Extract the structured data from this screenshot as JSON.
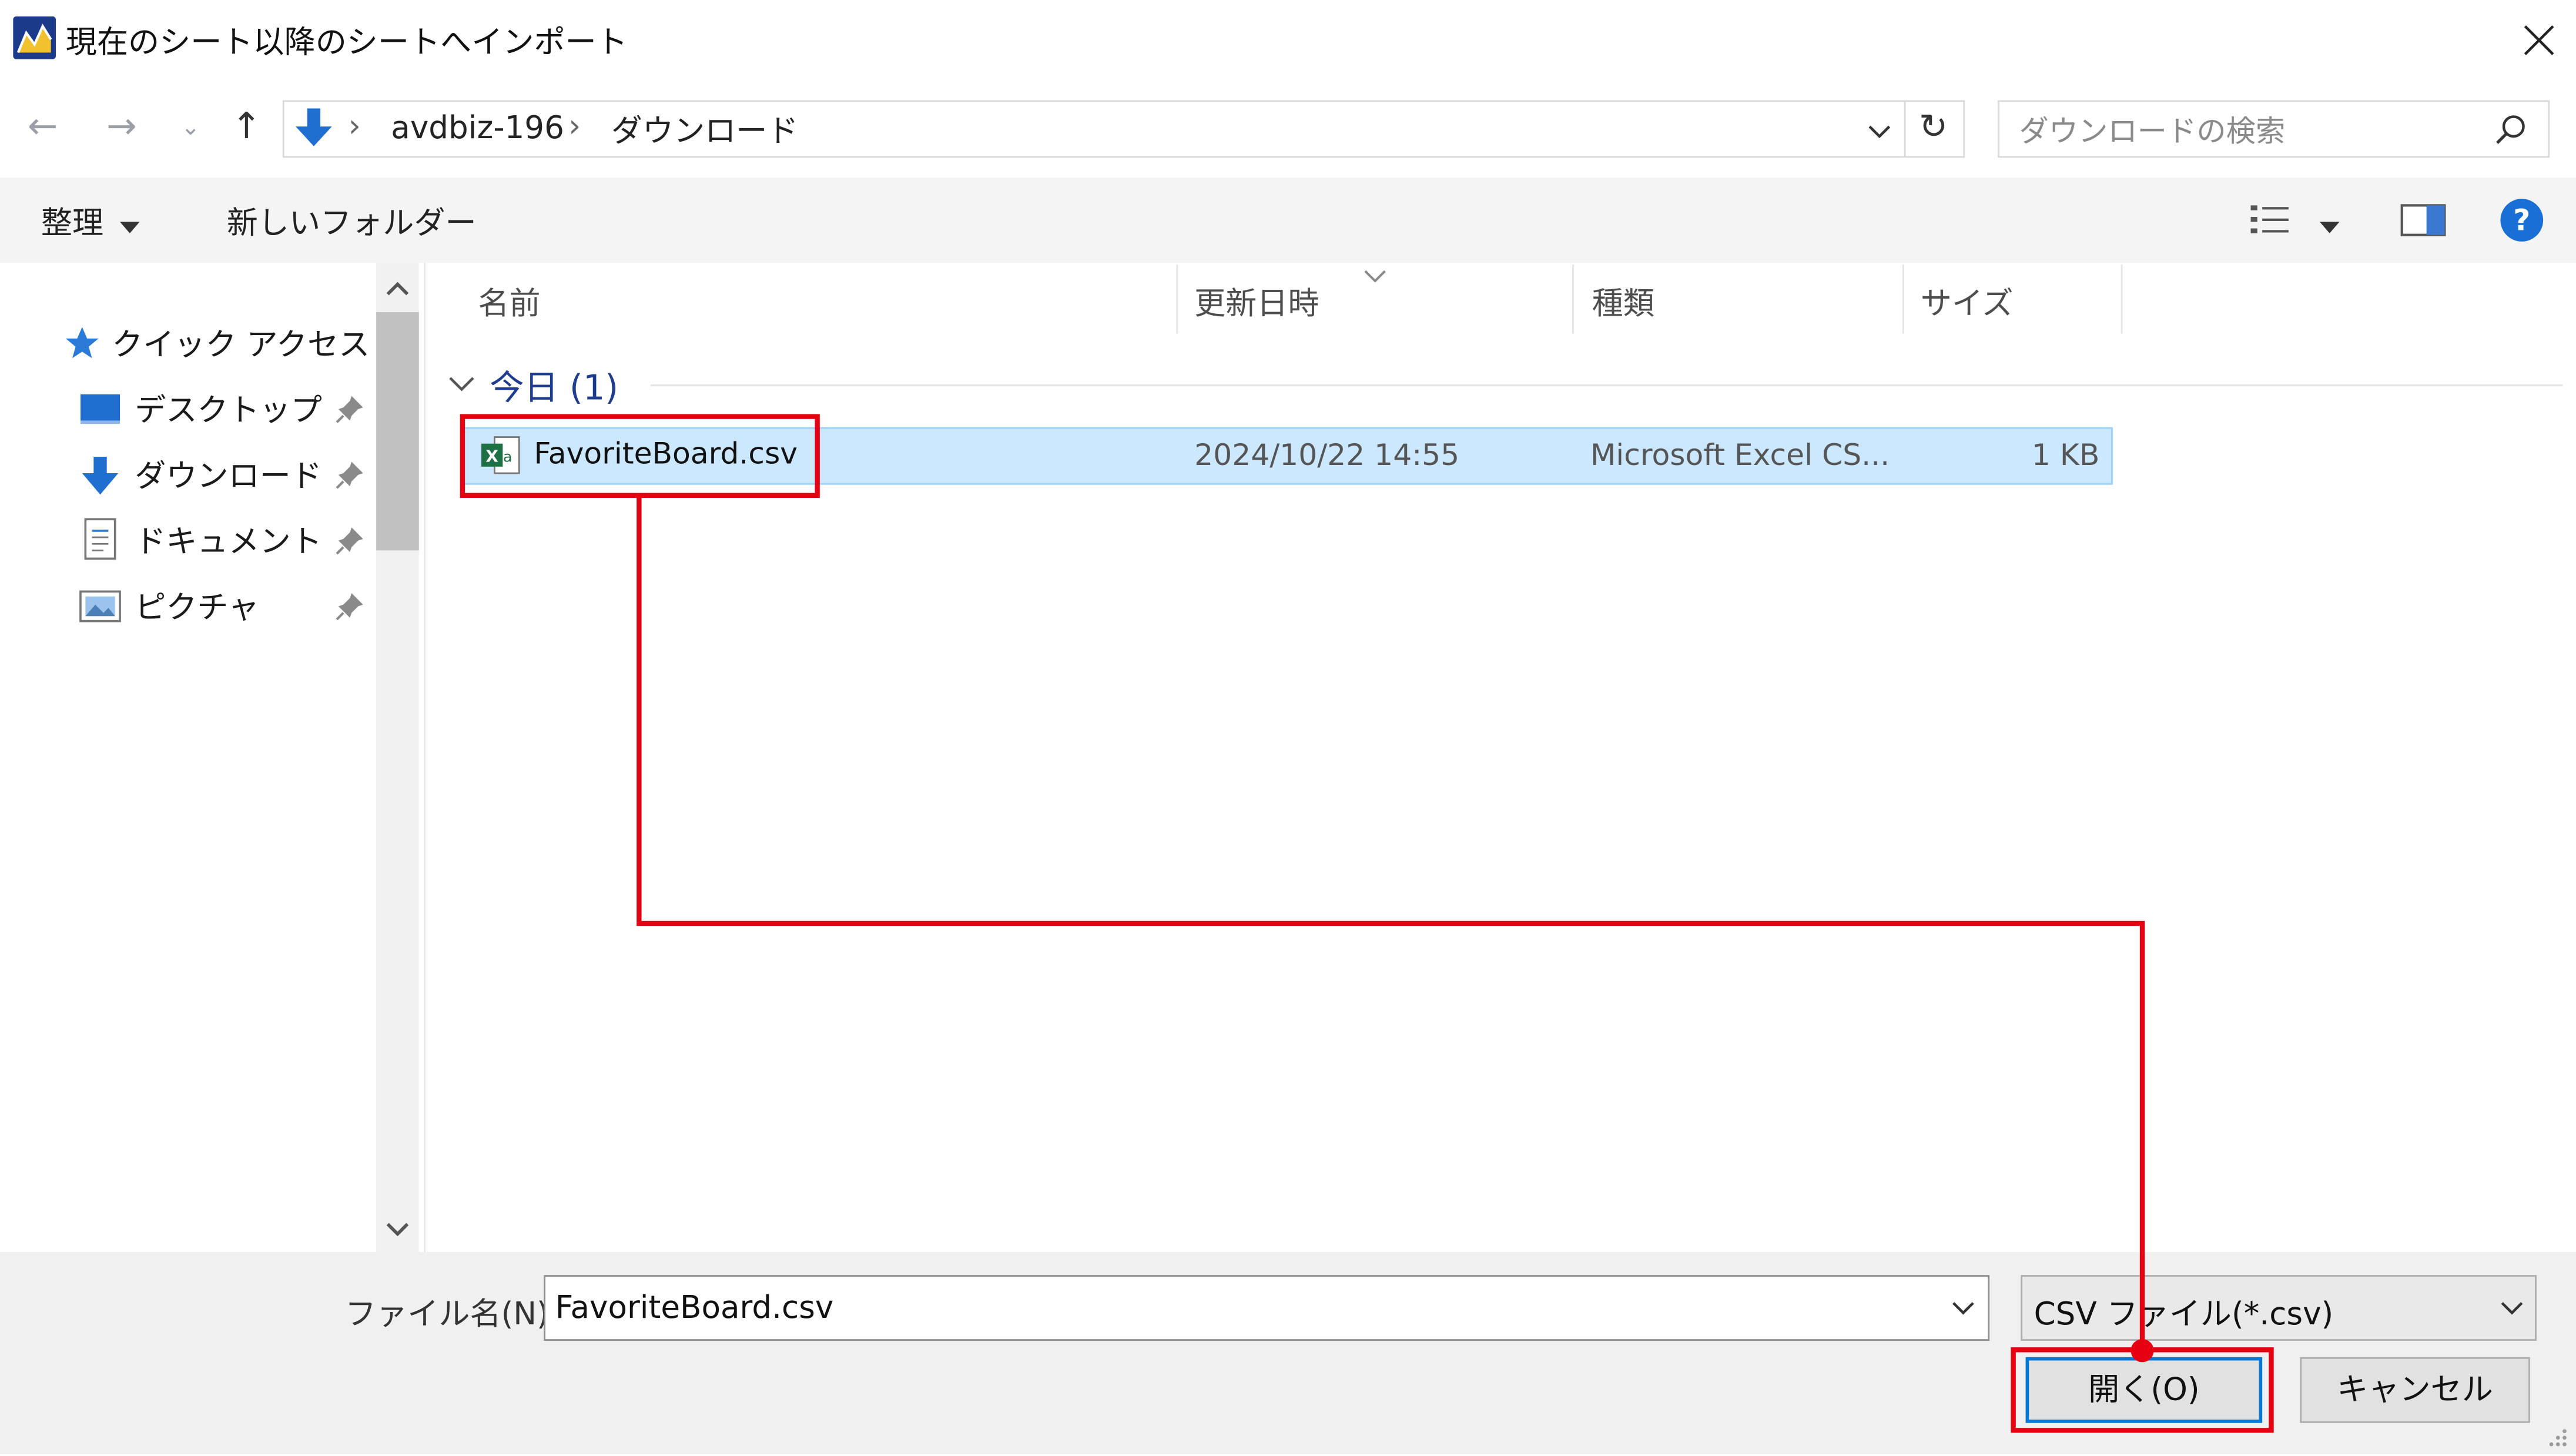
{
  "window": {
    "title": "現在のシート以降のシートへインポート",
    "app_icon": "app-logo-icon",
    "close_icon": "close-icon"
  },
  "address_bar": {
    "breadcrumb": [
      "avdbiz-196",
      "ダウンロード"
    ],
    "search_placeholder": "ダウンロードの検索"
  },
  "toolbar": {
    "organize_label": "整理",
    "new_folder_label": "新しいフォルダー",
    "help_icon": "help-icon"
  },
  "sidebar": {
    "quick_access_label": "クイック アクセス",
    "items": [
      {
        "label": "デスクトップ",
        "icon": "desktop-icon"
      },
      {
        "label": "ダウンロード",
        "icon": "download-icon"
      },
      {
        "label": "ドキュメント",
        "icon": "document-icon"
      },
      {
        "label": "ピクチャ",
        "icon": "pictures-icon"
      }
    ]
  },
  "file_list": {
    "columns": [
      "名前",
      "更新日時",
      "種類",
      "サイズ"
    ],
    "group_label": "今日 (1)",
    "rows": [
      {
        "name": "FavoriteBoard.csv",
        "modified": "2024/10/22 14:55",
        "type": "Microsoft Excel CS...",
        "size": "1 KB",
        "selected": true
      }
    ]
  },
  "bottom": {
    "filename_label": "ファイル名(N):",
    "filename_value": "FavoriteBoard.csv",
    "filetype_value": "CSV ファイル(*.csv)",
    "open_label": "開く(O)",
    "cancel_label": "キャンセル"
  },
  "colors": {
    "accent_blue": "#0078d7",
    "selection_bg": "#cce8ff",
    "annotation_red": "#e60012"
  }
}
